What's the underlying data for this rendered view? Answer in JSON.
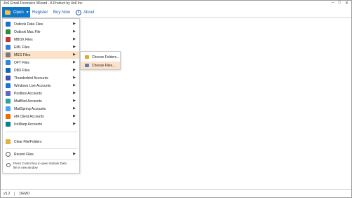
{
  "window": {
    "title": "4n6 Email Forensics Wizard - A Product by 4n6 Inc",
    "min": "–",
    "max": "□",
    "close": "✕"
  },
  "toolbar": {
    "open_label": "Open",
    "register_label": "Register",
    "buynow_label": "Buy Now",
    "about_label": "About",
    "about_icon_glyph": "i"
  },
  "menu": {
    "items": [
      {
        "label": "Outlook Data Files",
        "icon": "outlook-icon",
        "color": "#1e6fc9"
      },
      {
        "label": "Outlook Mac File",
        "icon": "outlook-mac-icon",
        "color": "#2d8a3e"
      },
      {
        "label": "MBOX Files",
        "icon": "mbox-icon",
        "color": "#c0392b"
      },
      {
        "label": "EML Files",
        "icon": "eml-icon",
        "color": "#3a7bd5"
      },
      {
        "label": "MSG Files",
        "icon": "msg-icon",
        "color": "#7a7a7a"
      },
      {
        "label": "OFT Files",
        "icon": "oft-icon",
        "color": "#2e86de"
      },
      {
        "label": "DBX Files",
        "icon": "dbx-icon",
        "color": "#1565c0"
      },
      {
        "label": "Thunderbird Accounts",
        "icon": "thunderbird-icon",
        "color": "#3f51b5"
      },
      {
        "label": "Windows Live Accounts",
        "icon": "windows-live-icon",
        "color": "#1976d2"
      },
      {
        "label": "Postbox Accounts",
        "icon": "postbox-icon",
        "color": "#5c6bc0"
      },
      {
        "label": "MailBird Accounts",
        "icon": "mailbird-icon",
        "color": "#26a69a"
      },
      {
        "label": "MailSpring Accounts",
        "icon": "mailspring-icon",
        "color": "#42a5f5"
      },
      {
        "label": "eM Client Accounts",
        "icon": "em-client-icon",
        "color": "#ef6c00"
      },
      {
        "label": "IceWarp Accounts",
        "icon": "icewarp-icon",
        "color": "#00838f"
      }
    ],
    "clear_label": "Clear File/Folders",
    "recent_label": "Recent Files",
    "tip_line1": "Press Control key to open Outlook Data",
    "tip_line2": "file in new window",
    "arrow_glyph": "▶"
  },
  "submenu": {
    "choose_folders": "Choose Folders...",
    "choose_files": "Choose Files..."
  },
  "status": {
    "version": "v5.2",
    "mode": "DEMO"
  },
  "colors": {
    "accent": "#0f77c9",
    "highlight": "#fbe2c9",
    "link": "#1f5fa6"
  }
}
